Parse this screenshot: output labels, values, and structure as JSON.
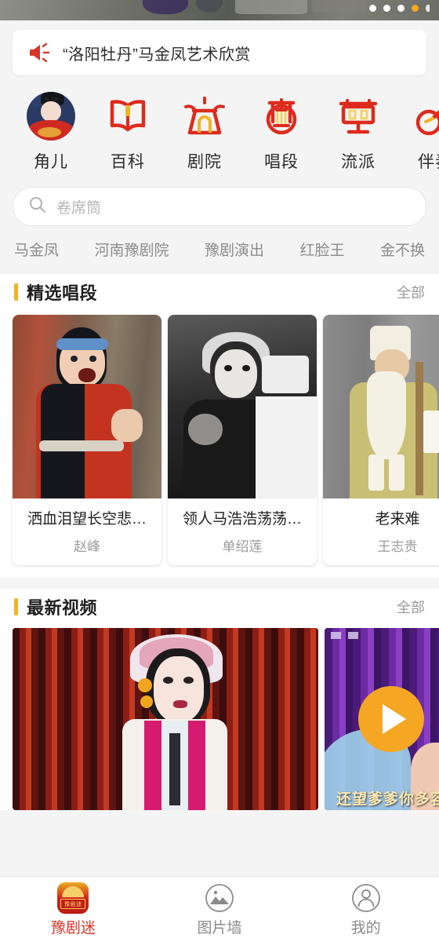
{
  "carousel": {
    "name": "top-banner-carousel",
    "dot_count": 4,
    "active_dot_index": 3,
    "active_dot_color": "#f0a81e",
    "dot_color": "#ffffff"
  },
  "notice": {
    "icon": "speaker-icon",
    "icon_color": "#d9372b",
    "text": "“洛阳牡丹”马金凤艺术欣赏"
  },
  "icon_nav": [
    {
      "label": "角儿",
      "icon": "avatar-photo-icon"
    },
    {
      "label": "百科",
      "icon": "open-book-icon"
    },
    {
      "label": "剧院",
      "icon": "theater-pavilion-icon"
    },
    {
      "label": "唱段",
      "icon": "lyre-icon"
    },
    {
      "label": "流派",
      "icon": "signboard-icon"
    },
    {
      "label": "伴奏",
      "icon": "string-instrument-icon"
    }
  ],
  "search": {
    "icon": "search-icon",
    "placeholder": "卷席筒",
    "value": ""
  },
  "hot_tags": [
    "马金凤",
    "河南豫剧院",
    "豫剧演出",
    "红脸王",
    "金不换"
  ],
  "sections": [
    {
      "title": "精选唱段",
      "all_label": "全部",
      "accent_color": "#f0b429",
      "cards": [
        {
          "title": "洒血泪望长空悲…",
          "artist": "赵峰",
          "thumb": "opera-red-black-costume-photo"
        },
        {
          "title": "领人马浩浩荡荡…",
          "artist": "单绍莲",
          "thumb": "opera-blackwhite-portrait-photo"
        },
        {
          "title": "老来难",
          "artist": "王志贵",
          "thumb": "opera-elder-yellow-robe-photo"
        }
      ]
    },
    {
      "title": "最新视频",
      "all_label": "全部",
      "accent_color": "#f0b429",
      "videos": [
        {
          "thumb": "opera-dan-red-curtain-video",
          "caption": "",
          "has_play": false
        },
        {
          "thumb": "opera-purple-stage-video",
          "caption": "还望爹爹你多容",
          "has_play": true,
          "play_color": "#f5a623"
        }
      ]
    }
  ],
  "tabbar": [
    {
      "label": "豫剧迷",
      "icon": "app-logo-icon",
      "active": true,
      "logo_text": "豫剧迷"
    },
    {
      "label": "图片墙",
      "icon": "image-wall-icon",
      "active": false
    },
    {
      "label": "我的",
      "icon": "person-icon",
      "active": false
    }
  ]
}
